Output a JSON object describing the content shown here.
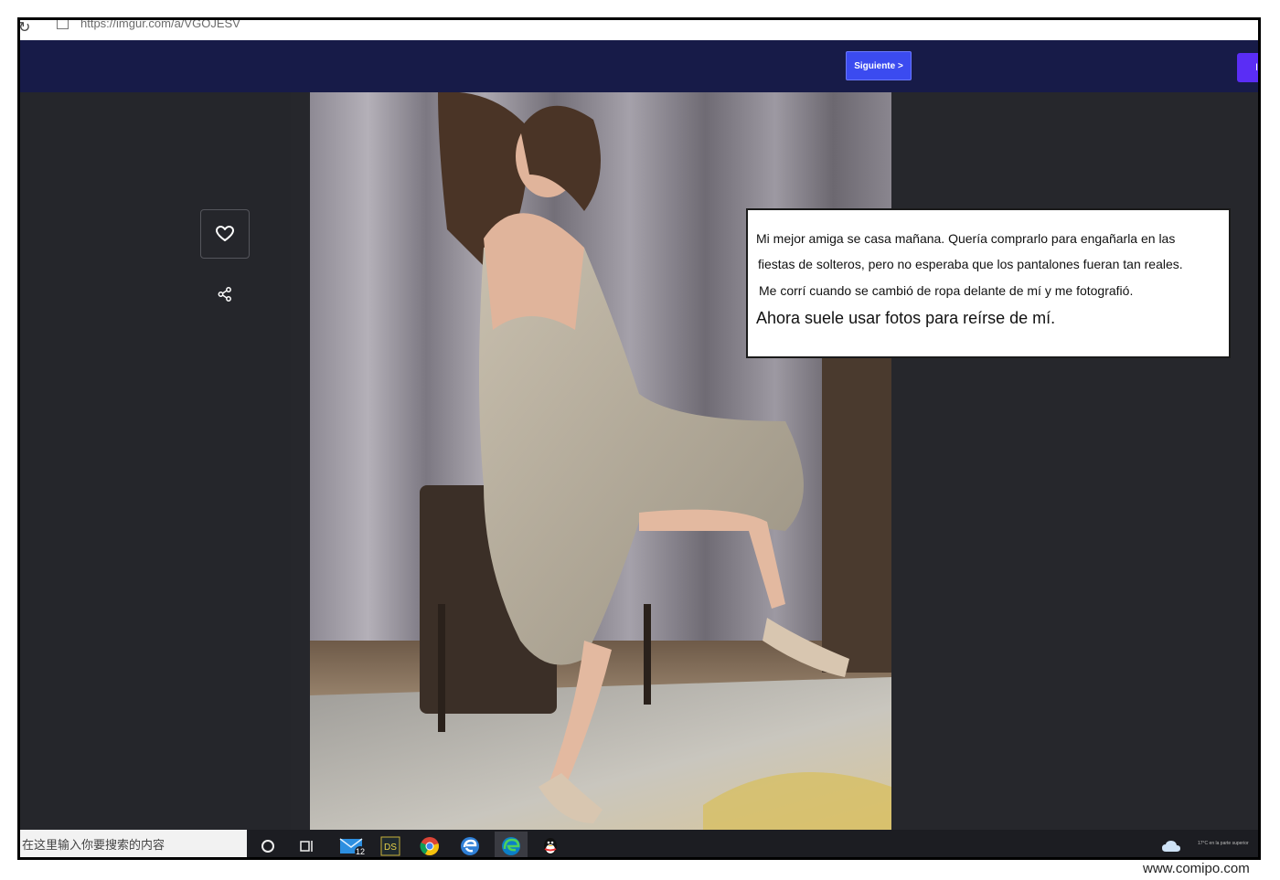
{
  "browser": {
    "url": "https://imgur.com/a/VGOJESV"
  },
  "navbar": {
    "next_label": "Siguiente >",
    "right_button_label": "In"
  },
  "post": {
    "caption_lines": [
      "Mi mejor amiga se casa mañana. Quería comprarlo para engañarla en las",
      "fiestas de solteros, pero no esperaba que los pantalones fueran tan reales.",
      "Me corrí cuando se cambió de ropa delante de mí y me fotografió.",
      "Ahora suele usar fotos para reírse de mí."
    ]
  },
  "actions": {
    "like_icon": "heart-icon",
    "share_icon": "share-icon"
  },
  "taskbar": {
    "search_placeholder": "在这里输入你要搜索的内容",
    "mail_badge": "12",
    "ds_label": "DS",
    "weather_text": "17°C en la parte superior"
  },
  "watermark": "www.comipo.com",
  "colors": {
    "navbar": "#171b48",
    "next_button": "#3b4bf0",
    "page_bg": "#26272c"
  }
}
